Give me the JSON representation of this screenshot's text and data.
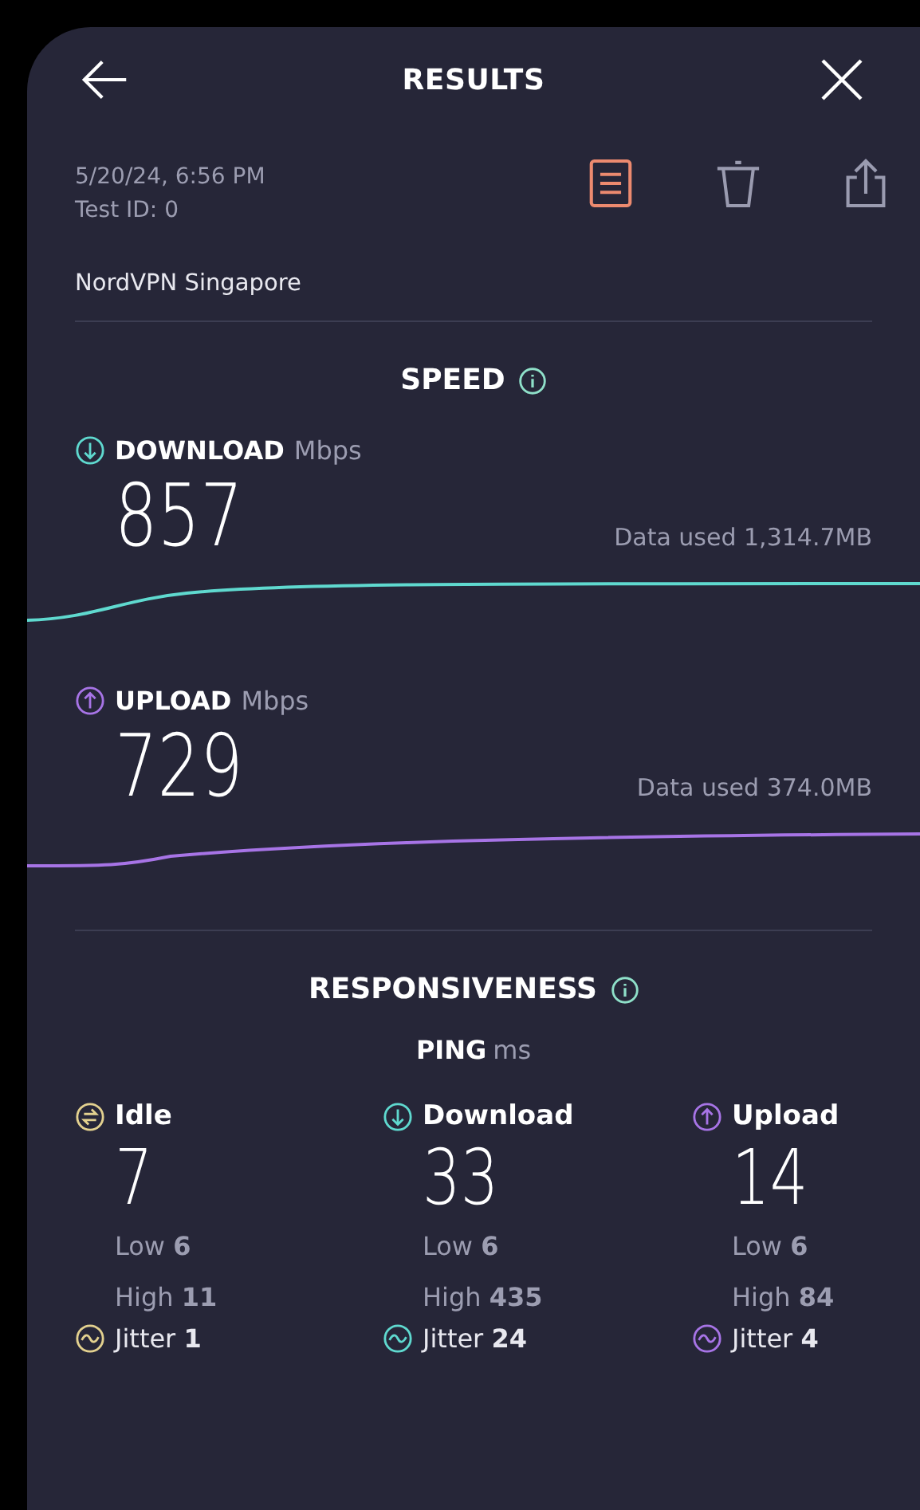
{
  "header": {
    "title": "RESULTS"
  },
  "test": {
    "date": "5/20/24, 6:56 PM",
    "test_id": "Test ID: 0",
    "server": "NordVPN Singapore"
  },
  "actions": [
    {
      "kind": "notes",
      "selected": true
    },
    {
      "kind": "delete",
      "selected": false
    },
    {
      "kind": "share",
      "selected": false
    }
  ],
  "speed": {
    "title": "SPEED",
    "metrics": [
      {
        "kind": "download",
        "label": "DOWNLOAD",
        "unit": "Mbps",
        "value": "857",
        "data_used": "Data used 1,314.7MB",
        "color": "#5fd9cf"
      },
      {
        "kind": "upload",
        "label": "UPLOAD",
        "unit": "Mbps",
        "value": "729",
        "data_used": "Data used 374.0MB",
        "color": "#a774e6"
      }
    ]
  },
  "responsiveness": {
    "title": "RESPONSIVENESS",
    "ping_label": "PING",
    "ping_unit": "ms",
    "columns": [
      {
        "kind": "idle",
        "label": "Idle",
        "value": "7",
        "low": "Low **6**",
        "high": "High **11**",
        "jitter": "Jitter **1**",
        "color": "#e3d18f"
      },
      {
        "kind": "download",
        "label": "Download",
        "value": "33",
        "low": "Low **6**",
        "high": "High **435**",
        "jitter": "Jitter **24**",
        "color": "#5fd9cf"
      },
      {
        "kind": "upload",
        "label": "Upload",
        "value": "14",
        "low": "Low **6**",
        "high": "High **84**",
        "jitter": "Jitter **4**",
        "color": "#a774e6"
      }
    ]
  }
}
